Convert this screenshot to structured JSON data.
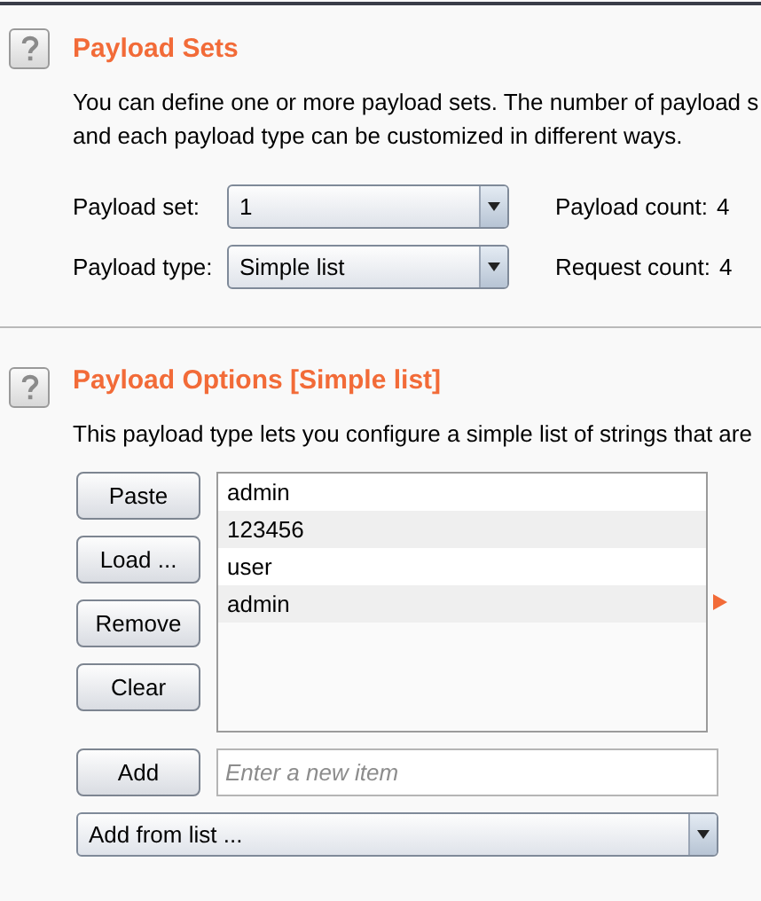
{
  "payload_sets": {
    "title": "Payload Sets",
    "description": [
      "You can define one or more payload sets. The number of payload s",
      "and each payload type can be customized in different ways."
    ],
    "fields": [
      {
        "label": "Payload set:",
        "value": "1",
        "count_label": "Payload count:",
        "count": "4"
      },
      {
        "label": "Payload type:",
        "value": "Simple list",
        "count_label": "Request count:",
        "count": "4"
      }
    ]
  },
  "payload_options": {
    "title": "Payload Options [Simple list]",
    "description": "This payload type lets you configure a simple list of strings that are",
    "buttons": [
      "Paste",
      "Load ...",
      "Remove",
      "Clear"
    ],
    "items": [
      "admin",
      "123456",
      "user",
      "admin"
    ],
    "add_button": "Add",
    "new_item": {
      "placeholder": "Enter a new item"
    },
    "add_from_list": "Add from list ..."
  }
}
